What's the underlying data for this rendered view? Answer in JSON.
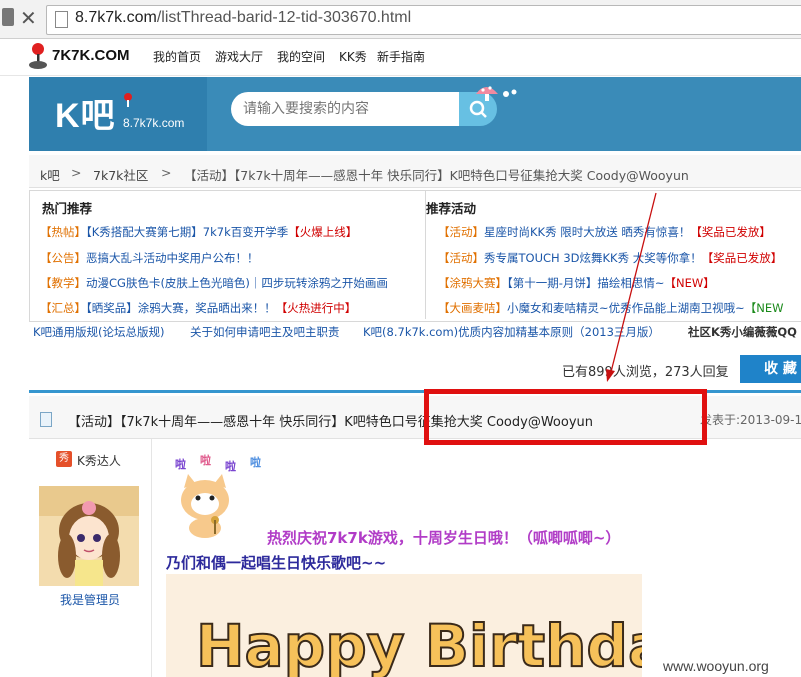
{
  "browser": {
    "url_host": "8.7k7k.com",
    "url_path": "/listThread-barid-12-tid-303670.html"
  },
  "topnav": {
    "logo": "7K7K.COM",
    "links": [
      "我的首页",
      "游戏大厅",
      "我的空间",
      "KK秀",
      "新手指南"
    ]
  },
  "banner": {
    "logo": "K吧",
    "domain": "8.7k7k.com",
    "search_placeholder": "请输入要搜索的内容"
  },
  "breadcrumb": {
    "items": [
      "k吧",
      "7k7k社区",
      "【活动】【7k7k十周年——感恩十年 快乐同行】K吧特色口号征集抢大奖 Coody@Wooyun"
    ],
    "separator": ">"
  },
  "hot": {
    "left_title": "热门推荐",
    "right_title": "推荐活动",
    "left_rows": [
      {
        "tag": "【热帖】",
        "text": "【K秀搭配大赛第七期】7k7k百变开学季",
        "extra": "【火爆上线】"
      },
      {
        "tag": "【公告】",
        "text": "恶搞大乱斗活动中奖用户公布！！",
        "extra": ""
      },
      {
        "tag": "【教学】",
        "text": "动漫CG肤色卡(皮肤上色光暗色)｜四步玩转涂鸦之开始画画",
        "extra": ""
      },
      {
        "tag": "【汇总】",
        "text": "【晒奖品】涂鸦大赛，奖品晒出来！！",
        "extra": "【火热进行中】"
      }
    ],
    "right_rows": [
      {
        "tag": "【活动】",
        "text": "星座时尚KK秀 限时大放送 晒秀有惊喜！",
        "extra": "【奖品已发放】",
        "extra_color": "red"
      },
      {
        "tag": "【活动】",
        "text": "秀专属TOUCH 3D炫舞KK秀 大奖等你拿！",
        "extra": "【奖品已发放】",
        "extra_color": "red"
      },
      {
        "tag": "【涂鸦大赛】",
        "text": "【第十一期-月饼】描绘相思情~",
        "extra": "【NEW】",
        "extra_color": "red"
      },
      {
        "tag": "【大画麦咭】",
        "text": "小魔女和麦咭精灵~优秀作品能上湖南卫视哦~",
        "extra": "【NEW",
        "extra_color": "green"
      }
    ]
  },
  "rules": [
    "K吧通用版规(论坛总版规)",
    "关于如何申请吧主及吧主职责",
    "K吧(8.7k7k.com)优质内容加精基本原则（2013三月版）",
    "社区K秀小编薇薇QQ"
  ],
  "stats": {
    "text": "已有899人浏览，273人回复",
    "fav_button": "收 藏"
  },
  "thread": {
    "title": "【活动】【7k7k十周年——感恩十年 快乐同行】K吧特色口号征集抢大奖 Coody@Wooyun",
    "date": "发表于:2013-09-1"
  },
  "user": {
    "badge_icon": "秀",
    "badge_label": "K秀达人",
    "name": "我是管理员"
  },
  "post": {
    "bubbles": [
      "啦",
      "啦",
      "啦",
      "啦"
    ],
    "celebrate": "热烈庆祝7k7k游戏，十周岁生日哦！（呱唧呱唧~）",
    "sing": "乃们和偶一起唱生日快乐歌吧~~",
    "cake_text": "Happy Birthday"
  },
  "watermark": "www.wooyun.org",
  "colors": {
    "highlight": "#e01010",
    "brand_blue": "#1f83c9"
  }
}
